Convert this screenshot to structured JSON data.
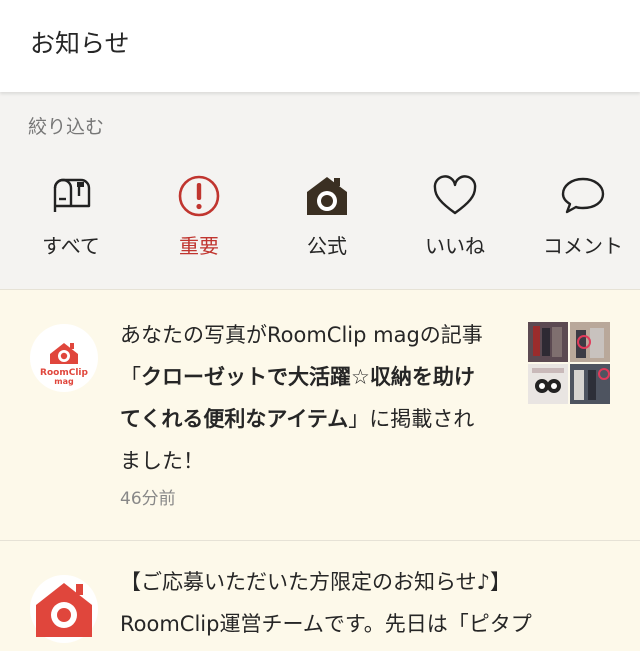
{
  "header": {
    "title": "お知らせ"
  },
  "filter": {
    "label": "絞り込む",
    "items": [
      {
        "label": "すべて",
        "icon": "mailbox-icon"
      },
      {
        "label": "重要",
        "icon": "exclamation-icon",
        "active": true
      },
      {
        "label": "公式",
        "icon": "camera-house-icon"
      },
      {
        "label": "いいね",
        "icon": "heart-icon"
      },
      {
        "label": "コメント",
        "icon": "speech-bubble-icon"
      }
    ]
  },
  "notifications": [
    {
      "avatar_text_1": "RoomClip",
      "avatar_text_2": "mag",
      "text_1": "あなたの写真がRoomClip magの記事「",
      "text_bold": "クローゼットで大活躍☆収納を助けてくれる便利なアイテム",
      "text_2": "」に掲載されました！",
      "time": "46分前"
    },
    {
      "text_1": "【ご応募いただいた方限定のお知らせ♪】",
      "text_2": "RoomClip運営チームです。先日は「ピタプ"
    }
  ],
  "colors": {
    "accent": "#c0352f",
    "brand_red": "#e0463c",
    "bg": "#f4f3f1",
    "card": "#fdf9ea"
  }
}
